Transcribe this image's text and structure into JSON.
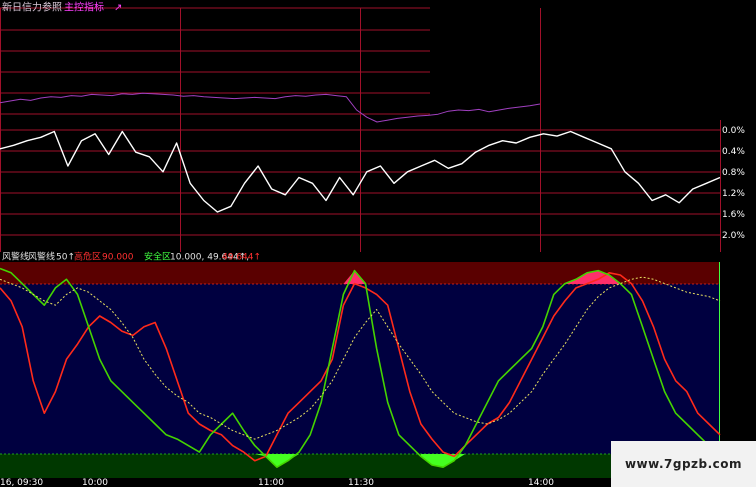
{
  "header": {
    "title": "新日信力参照",
    "link": "主控指标",
    "arrow": "↗"
  },
  "lower_legend": {
    "name1": "风警线",
    "name2": "风警线",
    "val": "50↑",
    "zone_hi": "高危区",
    "zone_hi_val": "90.000",
    "zone_safe": "安全区",
    "safe_vals": "10.000, 49.644↑,",
    "extra": "49.644↑"
  },
  "watermark": "www.7gpzb.com",
  "colors": {
    "background": "#000000",
    "grid": "#a0102a",
    "purple": "#a040c0",
    "white": "#ffffff",
    "red": "#ff2a1a",
    "green": "#44d400",
    "yellow": "#e8e060",
    "danger_band": "#5a0000",
    "safe_band": "#003800",
    "lower_bg": "#000040",
    "pink": "#ff2f6a"
  },
  "chart_data": [
    {
      "type": "line",
      "panel": "upper",
      "y_tick_labels": [
        "0.0%",
        "0.4%",
        "0.8%",
        "1.2%",
        "1.6%",
        "2.0%"
      ],
      "series": [
        {
          "color": "purple",
          "values": [
            0.62,
            0.65,
            0.68,
            0.66,
            0.7,
            0.72,
            0.71,
            0.74,
            0.73,
            0.76,
            0.75,
            0.74,
            0.77,
            0.76,
            0.78,
            0.77,
            0.76,
            0.75,
            0.73,
            0.74,
            0.72,
            0.71,
            0.7,
            0.69,
            0.7,
            0.71,
            0.7,
            0.69,
            0.72,
            0.74,
            0.73,
            0.75,
            0.76,
            0.74,
            0.72,
            0.5,
            0.38,
            0.3,
            0.33,
            0.36,
            0.38,
            0.4,
            0.41,
            0.43,
            0.48,
            0.5,
            0.49,
            0.51,
            0.47,
            0.5,
            0.53,
            0.55,
            0.57,
            0.6
          ]
        },
        {
          "color": "white",
          "values": [
            0.75,
            0.78,
            0.82,
            0.85,
            0.9,
            0.6,
            0.82,
            0.88,
            0.7,
            0.9,
            0.72,
            0.68,
            0.55,
            0.8,
            0.45,
            0.3,
            0.2,
            0.25,
            0.45,
            0.6,
            0.4,
            0.35,
            0.5,
            0.45,
            0.3,
            0.5,
            0.35,
            0.55,
            0.6,
            0.45,
            0.55,
            0.6,
            0.65,
            0.58,
            0.62,
            0.72,
            0.78,
            0.82,
            0.8,
            0.85,
            0.88,
            0.86,
            0.9,
            0.85,
            0.8,
            0.75,
            0.55,
            0.45,
            0.3,
            0.35,
            0.28,
            0.4,
            0.45,
            0.5
          ]
        }
      ]
    },
    {
      "type": "line",
      "panel": "lower",
      "x_tick_labels": [
        "16, 09:30",
        "10:00",
        "11:00",
        "11:30",
        "14:00"
      ],
      "thresholds": {
        "high": 90,
        "low": 10
      },
      "ylim": [
        0,
        100
      ],
      "series": [
        {
          "color": "red",
          "values": [
            88,
            82,
            70,
            45,
            30,
            40,
            55,
            62,
            70,
            75,
            72,
            68,
            66,
            70,
            72,
            60,
            45,
            30,
            25,
            22,
            20,
            15,
            12,
            8,
            10,
            20,
            30,
            35,
            40,
            45,
            55,
            80,
            90,
            88,
            85,
            80,
            60,
            40,
            25,
            18,
            12,
            10,
            15,
            20,
            25,
            28,
            35,
            45,
            55,
            65,
            75,
            82,
            88,
            90,
            92,
            95,
            94,
            90,
            82,
            70,
            55,
            45,
            40,
            30,
            25,
            20
          ]
        },
        {
          "color": "green",
          "values": [
            97,
            95,
            90,
            85,
            80,
            88,
            92,
            85,
            70,
            55,
            45,
            40,
            35,
            30,
            25,
            20,
            18,
            15,
            12,
            20,
            25,
            30,
            22,
            15,
            10,
            5,
            8,
            12,
            20,
            35,
            60,
            85,
            96,
            90,
            60,
            35,
            20,
            15,
            10,
            6,
            5,
            8,
            15,
            25,
            35,
            45,
            50,
            55,
            60,
            70,
            85,
            90,
            92,
            95,
            96,
            94,
            90,
            85,
            70,
            55,
            40,
            30,
            25,
            20,
            15,
            10
          ]
        },
        {
          "color": "yellow",
          "values": [
            92,
            90,
            88,
            85,
            82,
            80,
            85,
            88,
            86,
            82,
            78,
            72,
            65,
            55,
            48,
            42,
            38,
            35,
            30,
            28,
            25,
            22,
            20,
            18,
            20,
            22,
            25,
            28,
            32,
            38,
            45,
            55,
            65,
            72,
            78,
            70,
            62,
            55,
            48,
            40,
            35,
            30,
            28,
            26,
            25,
            27,
            30,
            35,
            40,
            48,
            55,
            62,
            70,
            78,
            84,
            88,
            90,
            92,
            93,
            92,
            90,
            88,
            86,
            85,
            84,
            82
          ]
        }
      ]
    }
  ]
}
